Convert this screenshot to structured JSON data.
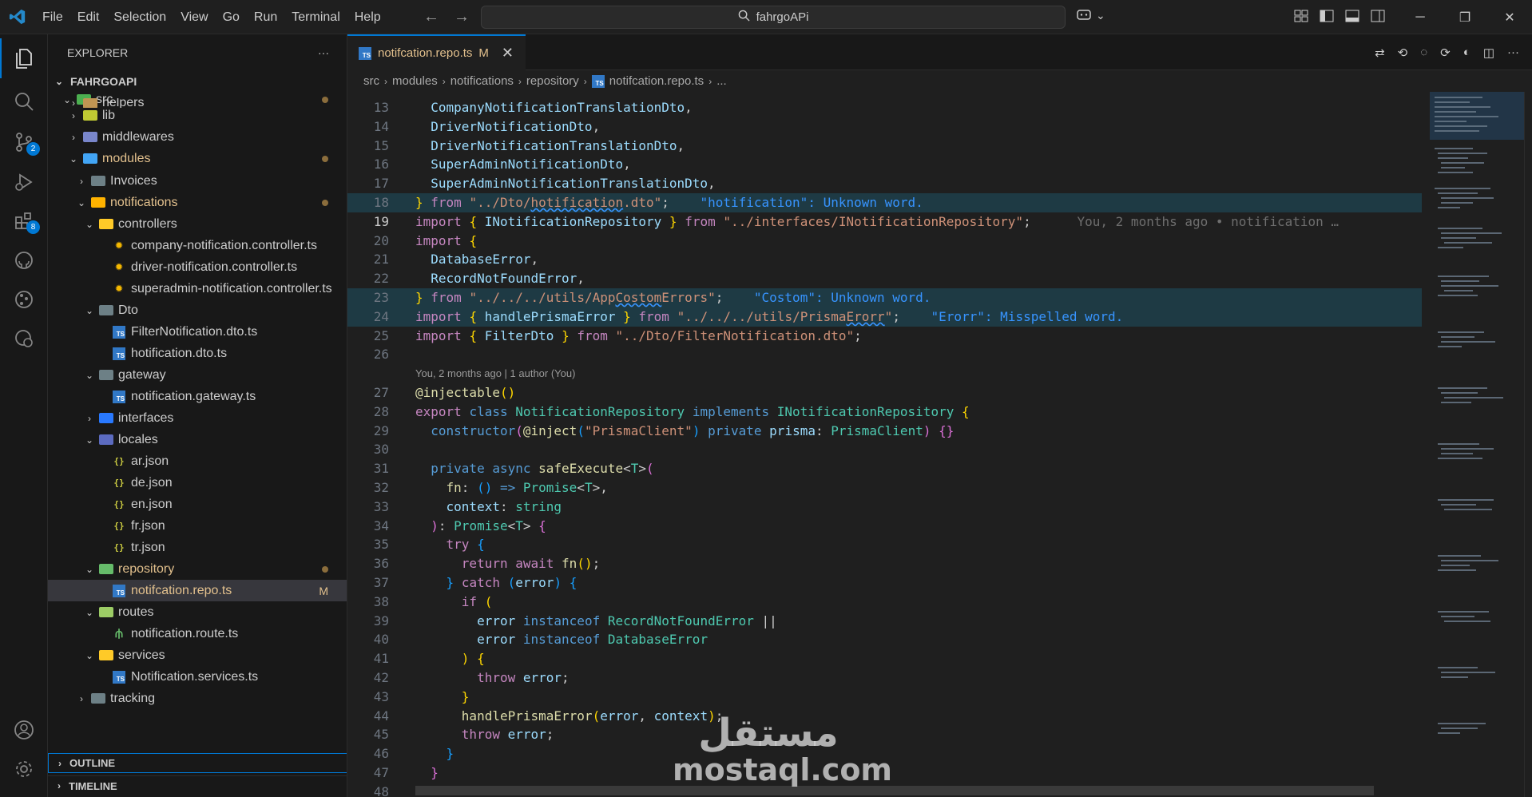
{
  "menu": [
    "File",
    "Edit",
    "Selection",
    "View",
    "Go",
    "Run",
    "Terminal",
    "Help"
  ],
  "search": {
    "text": "fahrgoAPi"
  },
  "activity": {
    "scm_badge": "2",
    "extensions_badge": "8"
  },
  "explorer": {
    "title": "EXPLORER",
    "more": "···",
    "root": "FAHRGOAPI",
    "rows": [
      {
        "label": "src"
      },
      {
        "label": "helpers"
      },
      {
        "label": "lib"
      },
      {
        "label": "middlewares"
      },
      {
        "label": "modules"
      },
      {
        "label": "Invoices"
      },
      {
        "label": "notifications"
      },
      {
        "label": "controllers"
      },
      {
        "label": "company-notification.controller.ts"
      },
      {
        "label": "driver-notification.controller.ts"
      },
      {
        "label": "superadmin-notification.controller.ts"
      },
      {
        "label": "Dto"
      },
      {
        "label": "FilterNotification.dto.ts"
      },
      {
        "label": "hotification.dto.ts"
      },
      {
        "label": "gateway"
      },
      {
        "label": "notification.gateway.ts"
      },
      {
        "label": "interfaces"
      },
      {
        "label": "locales"
      },
      {
        "label": "ar.json"
      },
      {
        "label": "de.json"
      },
      {
        "label": "en.json"
      },
      {
        "label": "fr.json"
      },
      {
        "label": "tr.json"
      },
      {
        "label": "repository"
      },
      {
        "label": "notifcation.repo.ts",
        "status": "M"
      },
      {
        "label": "routes"
      },
      {
        "label": "notification.route.ts"
      },
      {
        "label": "services"
      },
      {
        "label": "Notification.services.ts"
      },
      {
        "label": "tracking"
      }
    ],
    "outline": "OUTLINE",
    "timeline": "TIMELINE"
  },
  "editor": {
    "tab": {
      "label": "notifcation.repo.ts",
      "status": "M"
    },
    "breadcrumb": [
      "src",
      "modules",
      "notifications",
      "repository",
      "notifcation.repo.ts",
      "..."
    ],
    "blame_header": "You, 2 months ago | 1 author (You)",
    "line_numbers": [
      "13",
      "14",
      "15",
      "16",
      "17",
      "18",
      "19",
      "20",
      "21",
      "22",
      "23",
      "24",
      "25",
      "26",
      "",
      "27",
      "28",
      "29",
      "30",
      "31",
      "32",
      "33",
      "34",
      "35",
      "36",
      "37",
      "38",
      "39",
      "40",
      "41",
      "42",
      "43",
      "44",
      "45",
      "46",
      "47",
      "48"
    ],
    "diagnostics": {
      "l18": "\"hotification\": Unknown word.",
      "l19": "You, 2 months ago • notification …",
      "l23": "\"Costom\": Unknown word.",
      "l24": "\"Erorr\": Misspelled word."
    }
  },
  "watermark": {
    "arabic": "مستقل",
    "latin": "mostaql.com"
  },
  "colors": {
    "accent": "#0078d4",
    "modified": "#e2c08d"
  }
}
